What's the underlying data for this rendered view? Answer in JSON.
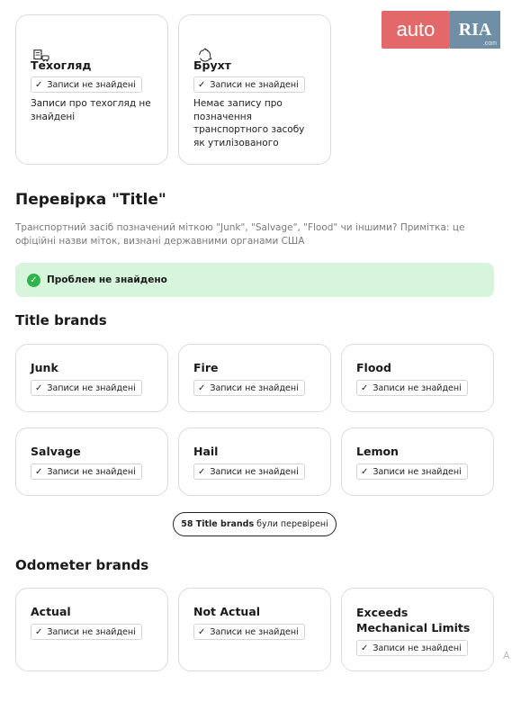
{
  "logo": {
    "left": "auto",
    "right": "RIA",
    "domain": ".com"
  },
  "top_cards": [
    {
      "icon": "document-car-icon",
      "title": "Техогляд",
      "badge": "Записи не знайдені",
      "desc": "Записи про техогляд не знайдені"
    },
    {
      "icon": "recycle-icon",
      "title": "Брухт",
      "badge": "Записи не знайдені",
      "desc": "Немає запису про позначення транспортного засобу як утилізованого"
    }
  ],
  "title_check": {
    "heading": "Перевірка \"Title\"",
    "subtitle": "Транспортний засіб позначений міткою \"Junk\", \"Salvage\", \"Flood\" чи іншими? Примітка: це офіційні назви міток, визнані державними органами США",
    "alert": "Проблем не знайдено"
  },
  "title_brands": {
    "heading": "Title brands",
    "items": [
      {
        "title": "Junk",
        "badge": "Записи не знайдені"
      },
      {
        "title": "Fire",
        "badge": "Записи не знайдені"
      },
      {
        "title": "Flood",
        "badge": "Записи не знайдені"
      },
      {
        "title": "Salvage",
        "badge": "Записи не знайдені"
      },
      {
        "title": "Hail",
        "badge": "Записи не знайдені"
      },
      {
        "title": "Lemon",
        "badge": "Записи не знайдені"
      }
    ],
    "checked_count": "58 Title brands",
    "checked_suffix": "були перевірені"
  },
  "odometer_brands": {
    "heading": "Odometer brands",
    "items": [
      {
        "title": "Actual",
        "badge": "Записи не знайдені"
      },
      {
        "title": "Not Actual",
        "badge": "Записи не знайдені"
      },
      {
        "title": "Exceeds Mechanical Limits",
        "badge": "Записи не знайдені"
      }
    ]
  },
  "colors": {
    "success_bg": "#d6f5dc",
    "success_icon": "#2fb34a",
    "logo_red": "#e2686a",
    "logo_blue": "#6f8fa6"
  }
}
